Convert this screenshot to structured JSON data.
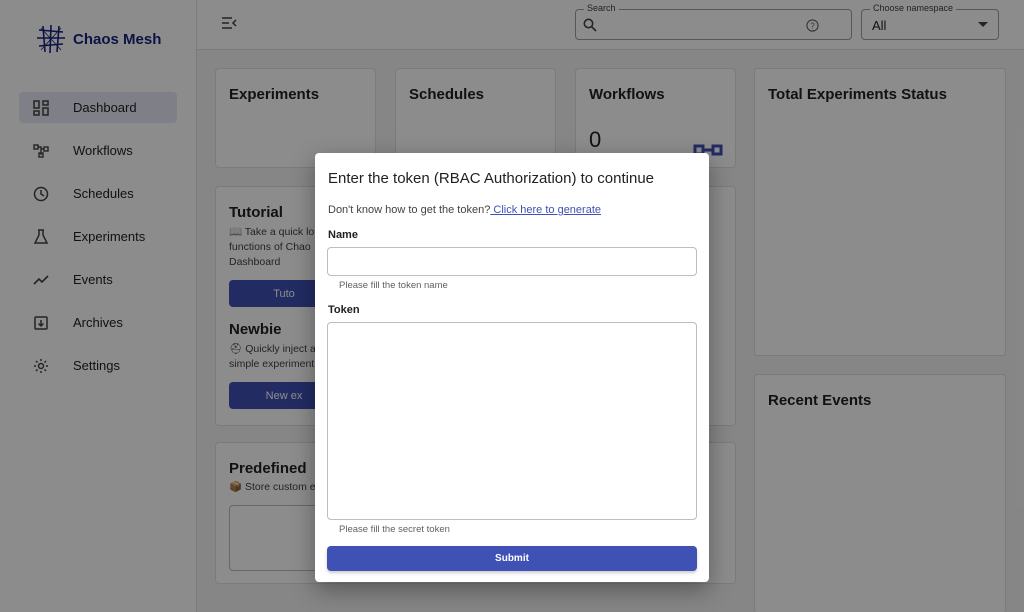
{
  "app": {
    "title": "Chaos Mesh"
  },
  "sidebar": {
    "items": [
      {
        "label": "Dashboard",
        "icon": "dashboard-icon",
        "active": true
      },
      {
        "label": "Workflows",
        "icon": "workflows-icon"
      },
      {
        "label": "Schedules",
        "icon": "clock-icon"
      },
      {
        "label": "Experiments",
        "icon": "flask-icon"
      },
      {
        "label": "Events",
        "icon": "trend-icon"
      },
      {
        "label": "Archives",
        "icon": "archive-icon"
      },
      {
        "label": "Settings",
        "icon": "gear-icon"
      }
    ]
  },
  "topbar": {
    "search_label": "Search",
    "search_value": "",
    "namespace_label": "Choose namespace",
    "namespace_value": "All"
  },
  "cards": {
    "experiments": "Experiments",
    "schedules": "Schedules",
    "workflows": "Workflows",
    "workflows_count": "0",
    "total_status": "Total Experiments Status",
    "recent_events": "Recent Events",
    "tutorial_title": "Tutorial",
    "tutorial_text": "📖 Take a quick lo functions of Chao Dashboard",
    "tutorial_button": "Tuto",
    "newbie_title": "Newbie",
    "newbie_text": "⛑ Quickly inject a simple experiment",
    "newbie_button": "New ex",
    "predefined_title": "Predefined",
    "predefined_text": "📦 Store custom e"
  },
  "dialog": {
    "title": "Enter the token (RBAC Authorization) to continue",
    "help_text": "Don't know how to get the token?",
    "help_link": " Click here to generate",
    "name_label": "Name",
    "name_value": "",
    "name_hint": "Please fill the token name",
    "token_label": "Token",
    "token_value": "",
    "token_hint": "Please fill the secret token",
    "submit": "Submit"
  },
  "colors": {
    "primary": "#3f51b5",
    "brand": "#1a237e"
  }
}
